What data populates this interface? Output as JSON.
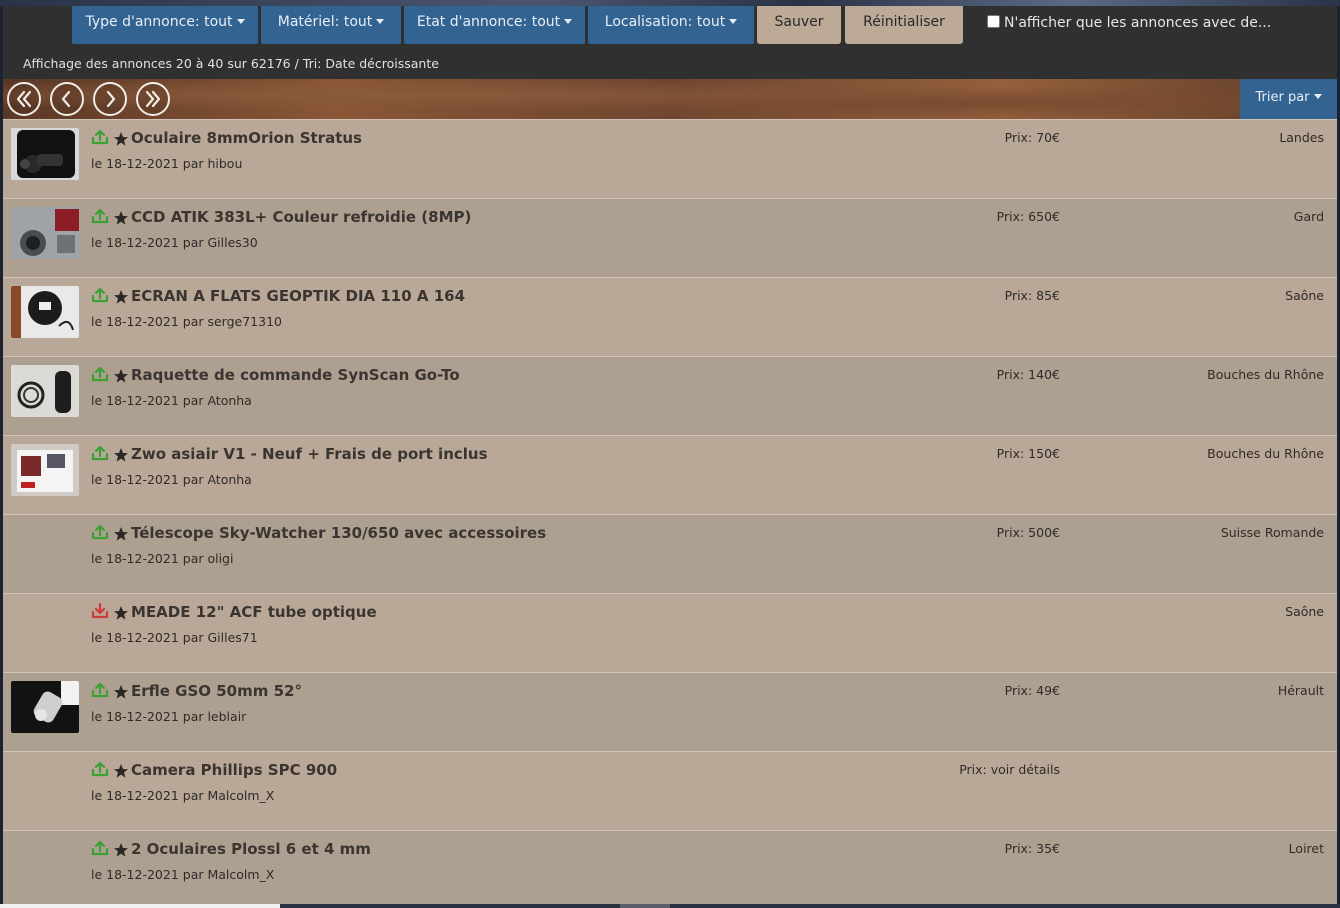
{
  "filters": {
    "type_label": "Type d'annonce: tout",
    "material_label": "Matériel: tout",
    "state_label": "Etat d'annonce: tout",
    "location_label": "Localisation: tout",
    "save_label": "Sauver",
    "reset_label": "Réinitialiser",
    "photo_only_label": "N'afficher que les annonces avec de..."
  },
  "summary": "Affichage des annonces 20 à 40 sur 62176 / Tri: Date décroissante",
  "nav": {
    "sort_label": "Trier par"
  },
  "colors": {
    "accent_blue": "#336391",
    "light_button": "#bca996",
    "status_up": "#3aa034",
    "status_down": "#d03a3a"
  },
  "listings": [
    {
      "title": "Oculaire 8mmOrion Stratus",
      "meta": "le 18-12-2021 par hibou",
      "price": "Prix: 70€",
      "location": "Landes",
      "status": "up",
      "thumb": "eyepiece"
    },
    {
      "title": "CCD ATIK 383L+ Couleur refroidie (8MP)",
      "meta": "le 18-12-2021 par Gilles30",
      "price": "Prix: 650€",
      "location": "Gard",
      "status": "up",
      "thumb": "camera"
    },
    {
      "title": "ECRAN A FLATS GEOPTIK DIA 110 A 164",
      "meta": "le 18-12-2021 par serge71310",
      "price": "Prix: 85€",
      "location": "Saône",
      "status": "up",
      "thumb": "panel"
    },
    {
      "title": "Raquette de commande SynScan Go-To",
      "meta": "le 18-12-2021 par Atonha",
      "price": "Prix: 140€",
      "location": "Bouches du Rhône",
      "status": "up",
      "thumb": "remote"
    },
    {
      "title": "Zwo asiair V1 - Neuf + Frais de port inclus",
      "meta": "le 18-12-2021 par Atonha",
      "price": "Prix: 150€",
      "location": "Bouches du Rhône",
      "status": "up",
      "thumb": "box"
    },
    {
      "title": "Télescope Sky-Watcher 130/650 avec accessoires",
      "meta": "le 18-12-2021 par oligi",
      "price": "Prix: 500€",
      "location": "Suisse Romande",
      "status": "up",
      "thumb": ""
    },
    {
      "title": "MEADE 12\" ACF tube optique",
      "meta": "le 18-12-2021 par Gilles71",
      "price": "",
      "location": "Saône",
      "status": "down",
      "thumb": ""
    },
    {
      "title": "Erfle GSO 50mm 52°",
      "meta": "le 18-12-2021 par leblair",
      "price": "Prix: 49€",
      "location": "Hérault",
      "status": "up",
      "thumb": "erfle"
    },
    {
      "title": "Camera Phillips SPC 900",
      "meta": "le 18-12-2021 par Malcolm_X",
      "price": "Prix: voir détails",
      "location": "",
      "status": "up",
      "thumb": ""
    },
    {
      "title": "2 Oculaires Plossl 6 et 4 mm",
      "meta": "le 18-12-2021 par Malcolm_X",
      "price": "Prix: 35€",
      "location": "Loiret",
      "status": "up",
      "thumb": ""
    }
  ]
}
